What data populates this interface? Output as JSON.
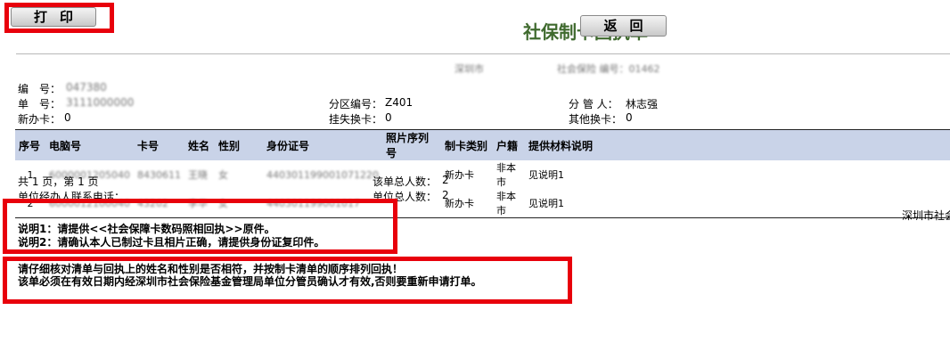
{
  "toolbar": {
    "print_label": "打印",
    "back_label": "返回"
  },
  "title": "社保制卡回执单",
  "subtitle_left": "深圳市",
  "subtitle_right": "社会保险 编号：01462",
  "info": {
    "serial_label": "编　号：",
    "serial_value": "047380",
    "doc_no_label": "单　号：",
    "doc_no_value": "3111000000",
    "district_label": "分区编号：",
    "district_value": "Z401",
    "manager_label": "分 管 人：",
    "manager_value": "林志强",
    "new_card_label": "新办卡：",
    "new_card_value": "0",
    "report_loss_label": "挂失换卡：",
    "report_loss_value": "0",
    "other_label": "其他换卡：",
    "other_value": "0"
  },
  "table": {
    "headers": [
      "序号",
      "电脑号",
      "卡号",
      "姓名",
      "性别",
      "身份证号",
      "照片序列号",
      "制卡类别",
      "户籍",
      "提供材料说明"
    ],
    "rows": [
      {
        "no": "1",
        "computer_no": "6000001205040",
        "card_no": "8430611",
        "name": "王晓",
        "gender": "女",
        "id_no": "440301199001071220",
        "photo_no": "",
        "card_type": "新办卡",
        "household": "非本市",
        "material": "见说明1"
      },
      {
        "no": "2",
        "computer_no": "6000012100040",
        "card_no": "43202",
        "name": "李华",
        "gender": "女",
        "id_no": "440301199001017",
        "photo_no": "",
        "card_type": "新办卡",
        "household": "非本市",
        "material": "见说明1"
      }
    ]
  },
  "footer": {
    "pages": "共 1 页，第 1 页",
    "total1_label": "该单总人数：",
    "total1_value": "2",
    "contact_label": "单位经办人联系电话：",
    "total2_label": "单位总人数：",
    "total2_value": "2",
    "right_partial": "深圳市社会"
  },
  "notes": {
    "note1": "说明1：请提供<<社会保障卡数码照相回执>>原件。",
    "note2": "说明2：请确认本人已制过卡且相片正确，请提供身份证复印件。"
  },
  "warnings": {
    "line1": "请仔细核对清单与回执上的姓名和性别是否相符，并按制卡清单的顺序排列回执！",
    "line2": "该单必须在有效日期内经深圳市社会保险基金管理局单位分管员确认才有效,否则要重新申请打单。"
  }
}
